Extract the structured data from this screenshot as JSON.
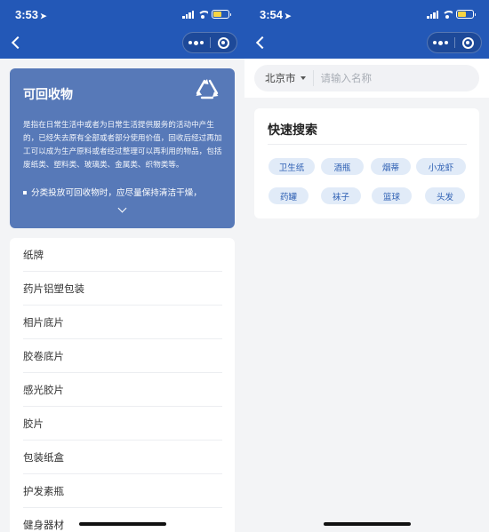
{
  "left_screen": {
    "status": {
      "time": "3:53"
    },
    "hero": {
      "title": "可回收物",
      "description": "是指在日常生活中或者为日常生活提供服务的活动中产生的，已经失去原有全部或者部分使用价值，回收后经过再加工可以成为生产原料或者经过整理可以再利用的物品，包括废纸类、塑料类、玻璃类、金属类、织物类等。",
      "tip": "分类投放可回收物时，应尽量保持清洁干燥，"
    },
    "items": [
      "纸牌",
      "药片铝塑包装",
      "相片底片",
      "胶卷底片",
      "感光胶片",
      "胶片",
      "包装纸盒",
      "护发素瓶",
      "健身器材"
    ]
  },
  "right_screen": {
    "status": {
      "time": "3:54"
    },
    "search": {
      "city": "北京市",
      "placeholder": "请输入名称"
    },
    "quick_search": {
      "title": "快速搜索",
      "tags": [
        "卫生纸",
        "酒瓶",
        "烟蒂",
        "小龙虾",
        "药罐",
        "袜子",
        "篮球",
        "头发"
      ]
    }
  },
  "colors": {
    "nav_blue": "#2358b7",
    "hero_blue": "#5779b8",
    "tag_bg": "#e1ebf8",
    "tag_text": "#2d5fb3"
  }
}
